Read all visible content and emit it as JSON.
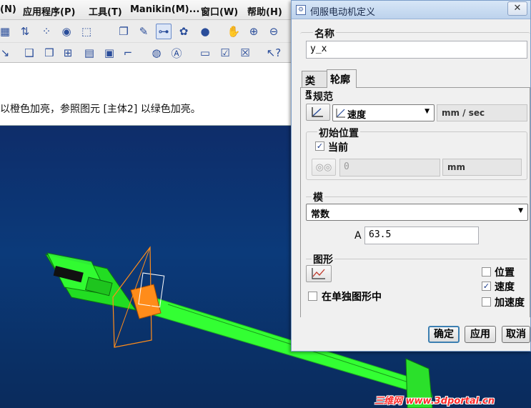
{
  "menubar": {
    "items": [
      "(N)",
      "应用程序(P)",
      "工具(T)",
      "Manikin(M)...",
      "窗口(W)",
      "帮助(H)"
    ]
  },
  "message": {
    "text": "以橙色加亮，参照图元 [主体2] 以绿色加亮。"
  },
  "dialog": {
    "title": "伺服电动机定义",
    "close_label": "✕",
    "name_section": {
      "label": "名称",
      "value": "y_x"
    },
    "tabs": [
      {
        "label": "类型",
        "active": false
      },
      {
        "label": "轮廓",
        "active": true
      }
    ],
    "spec": {
      "label": "规范",
      "type_value": "速度",
      "unit": "mm / sec"
    },
    "initial_position": {
      "label": "初始位置",
      "current_label": "当前",
      "current_checked": true,
      "value": "0",
      "unit": "mm"
    },
    "mode": {
      "label": "模",
      "value": "常数",
      "param_label": "A",
      "param_value": "63.5"
    },
    "graph": {
      "label": "图形",
      "separate_label": "在单独图形中",
      "separate_checked": false,
      "options": [
        {
          "label": "位置",
          "checked": false
        },
        {
          "label": "速度",
          "checked": true
        },
        {
          "label": "加速度",
          "checked": false
        }
      ]
    },
    "buttons": {
      "ok": "确定",
      "apply": "应用",
      "cancel": "取消"
    }
  },
  "watermark": {
    "text": "三维网 www.3dportal.cn"
  },
  "colors": {
    "viewport_bg": "#0b3a7a",
    "highlight_green": "#33ff33",
    "highlight_orange": "#ff8c1a",
    "dialog_bg": "#f0f0f0"
  }
}
